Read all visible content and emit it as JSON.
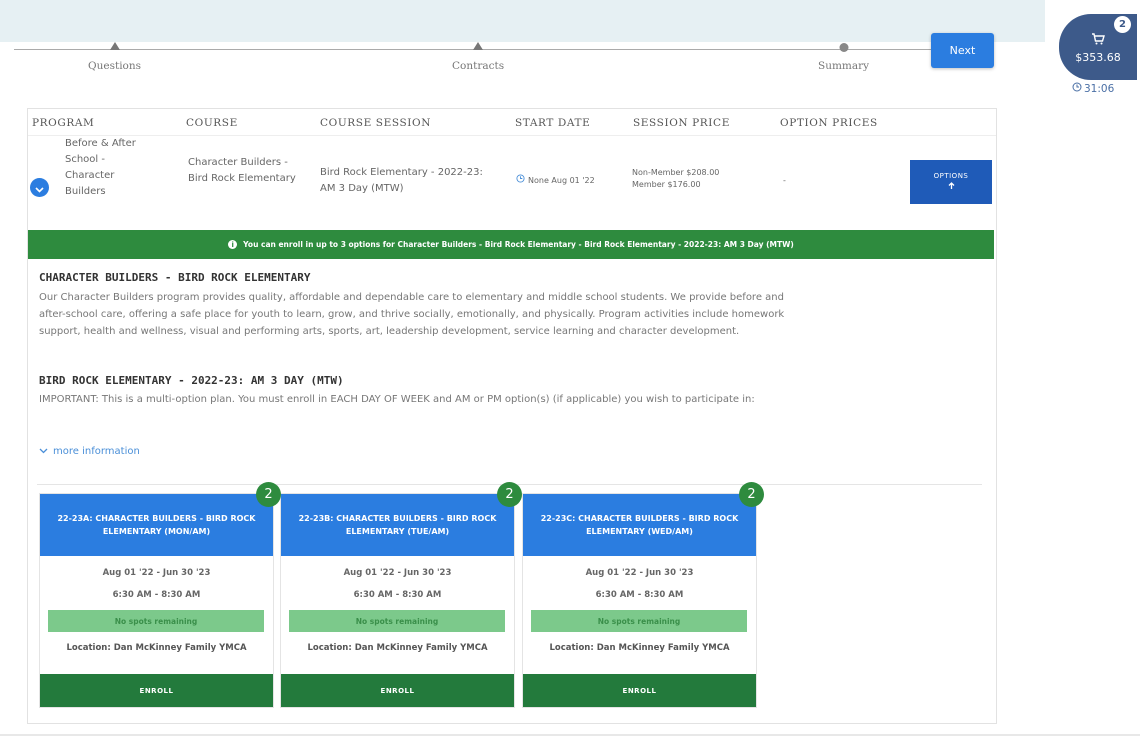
{
  "steps": [
    {
      "label": "Questions"
    },
    {
      "label": "Contracts"
    },
    {
      "label": "Summary"
    }
  ],
  "next_label": "Next",
  "cart": {
    "count": "2",
    "total": "$353.68",
    "timer": "31:06"
  },
  "table": {
    "headers": [
      "PROGRAM",
      "COURSE",
      "COURSE SESSION",
      "START DATE",
      "SESSION PRICE",
      "OPTION PRICES"
    ],
    "row": {
      "program": "Before & After School - Character Builders",
      "course": "Character Builders - Bird Rock Elementary",
      "session": "Bird Rock Elementary - 2022-23: AM 3 Day (MTW)",
      "start_date": "None Aug 01 '22",
      "price_non_member": "Non-Member $208.00",
      "price_member": "Member $176.00",
      "option_prices": "-",
      "options_label": "OPTIONS"
    }
  },
  "banner": "You can enroll in up to 3 options for Character Builders - Bird Rock Elementary - Bird Rock Elementary - 2022-23: AM 3 Day (MTW)",
  "course_title": "CHARACTER BUILDERS - BIRD ROCK ELEMENTARY",
  "course_desc": "Our Character Builders program provides quality, affordable and dependable care to elementary and middle school students. We provide before and after-school care, offering a safe place for youth to learn, grow, and thrive socially, emotionally, and physically. Program activities include homework support, health and wellness, visual and performing arts, sports, art, leadership development, service learning and character development.",
  "session_title": "BIRD ROCK ELEMENTARY - 2022-23: AM 3 DAY (MTW)",
  "session_desc": "IMPORTANT: This is a multi-option plan. You must enroll in EACH DAY OF WEEK and AM or PM option(s) (if applicable) you wish to participate in:",
  "more_info": "more information",
  "options": [
    {
      "title": "22-23A: CHARACTER BUILDERS - BIRD ROCK ELEMENTARY (MON/AM)",
      "badge": "2",
      "dates": "Aug 01 '22 - Jun 30 '23",
      "times": "6:30 AM - 8:30 AM",
      "spots": "No spots remaining",
      "location": "Location: Dan McKinney Family YMCA",
      "enroll": "ENROLL"
    },
    {
      "title": "22-23B: CHARACTER BUILDERS - BIRD ROCK ELEMENTARY (TUE/AM)",
      "badge": "2",
      "dates": "Aug 01 '22 - Jun 30 '23",
      "times": "6:30 AM - 8:30 AM",
      "spots": "No spots remaining",
      "location": "Location: Dan McKinney Family YMCA",
      "enroll": "ENROLL"
    },
    {
      "title": "22-23C: CHARACTER BUILDERS - BIRD ROCK ELEMENTARY (WED/AM)",
      "badge": "2",
      "dates": "Aug 01 '22 - Jun 30 '23",
      "times": "6:30 AM - 8:30 AM",
      "spots": "No spots remaining",
      "location": "Location: Dan McKinney Family YMCA",
      "enroll": "ENROLL"
    }
  ]
}
